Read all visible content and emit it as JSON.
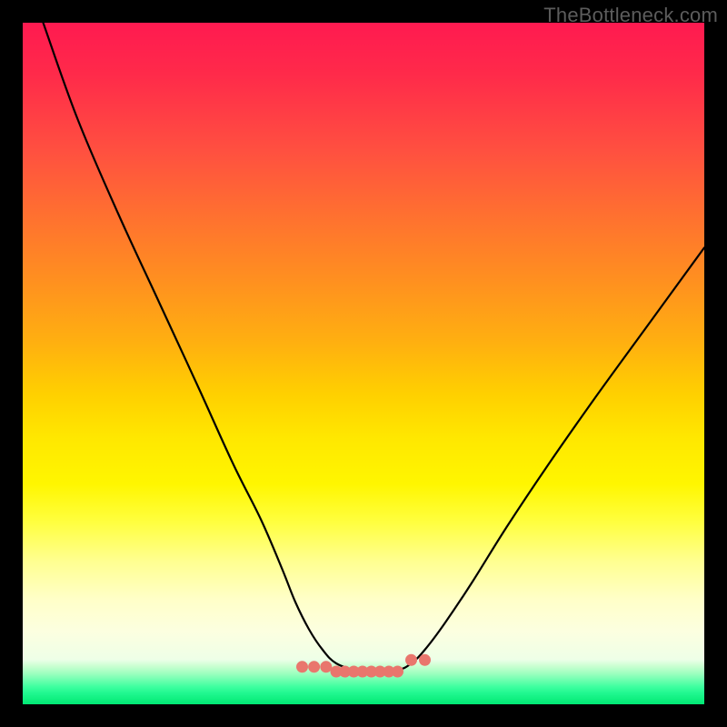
{
  "watermark": "TheBottleneck.com",
  "chart_data": {
    "type": "line",
    "title": "",
    "xlabel": "",
    "ylabel": "",
    "xlim": [
      0,
      100
    ],
    "ylim": [
      0,
      100
    ],
    "grid": false,
    "legend": false,
    "series": [
      {
        "name": "bottleneck-curve",
        "x": [
          3,
          8,
          14,
          20,
          26,
          31,
          35,
          38,
          40,
          42,
          44,
          46,
          49,
          52,
          55,
          57,
          59,
          62,
          66,
          71,
          77,
          84,
          92,
          100
        ],
        "y": [
          100,
          86,
          72,
          59,
          46,
          35,
          27,
          20,
          15,
          11,
          8,
          6,
          5,
          5,
          5,
          6,
          8,
          12,
          18,
          26,
          35,
          45,
          56,
          67
        ],
        "mode": "smooth"
      },
      {
        "name": "bottom-marker-left",
        "type": "marker-range",
        "x_range": [
          41,
          44.5
        ],
        "y": 5.5,
        "style": "dotted-red"
      },
      {
        "name": "bottom-marker-mid",
        "type": "marker-range",
        "x_range": [
          46,
          55
        ],
        "y": 4.8,
        "style": "dotted-red"
      },
      {
        "name": "bottom-marker-right",
        "type": "marker-range",
        "x_range": [
          57,
          59
        ],
        "y": 6.5,
        "style": "dotted-red"
      }
    ],
    "background": {
      "type": "vertical-gradient",
      "stops": [
        {
          "pos": 0.0,
          "color": "#ff1a50"
        },
        {
          "pos": 0.4,
          "color": "#ff8f20"
        },
        {
          "pos": 0.62,
          "color": "#ffe000"
        },
        {
          "pos": 0.82,
          "color": "#ffff70"
        },
        {
          "pos": 0.93,
          "color": "#f0ffe0"
        },
        {
          "pos": 1.0,
          "color": "#00e874"
        }
      ]
    }
  }
}
